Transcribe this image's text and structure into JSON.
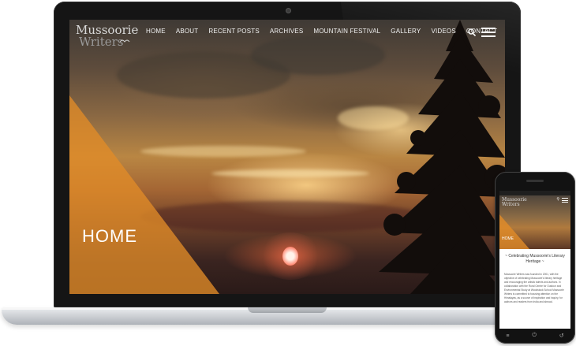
{
  "site": {
    "logo_line1": "Mussoorie",
    "logo_line2": "Writers",
    "nav": [
      "HOME",
      "ABOUT",
      "RECENT POSTS",
      "ARCHIVES",
      "MOUNTAIN FESTIVAL",
      "GALLERY",
      "VIDEOS",
      "CONTACT"
    ],
    "hero_title": "HOME"
  },
  "mobile": {
    "logo_line1": "Mussoorie",
    "logo_line2": "Writers",
    "hero_title": "HOME",
    "tagline": "~ Celebrating Mussoorie's Literary Heritage ~",
    "body_text": "Mussoorie Writers was founded in 2001, with the objective of celebrating Mussoorie's literary heritage and encouraging the artistic talents and authors. In collaboration with the Rural Centre for Outdoor and Environmental Study at Woodstock School Mussoorie Writers is committed to focusing attention on the Himalayas, as a source of inspiration and inquiry, for authors and readers from India and abroad."
  },
  "colors": {
    "accent_orange": "#e28c28",
    "laptop_bezel": "#151515",
    "nav_text": "#f1f1f1"
  },
  "icons": [
    "search-icon",
    "hamburger-menu-icon",
    "bird-logo-icon",
    "camera-icon"
  ]
}
